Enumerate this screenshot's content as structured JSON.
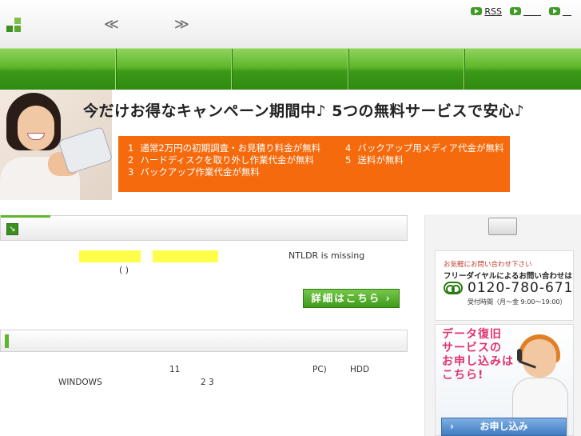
{
  "header": {
    "nav_prev": "≪",
    "nav_next": "≫",
    "links": [
      {
        "label": "RSS",
        "icon": "play-icon"
      },
      {
        "label": "＿＿",
        "icon": "play-icon"
      },
      {
        "label": "＿",
        "icon": "play-icon"
      }
    ]
  },
  "nav": {
    "items": [
      "",
      "",
      "",
      "",
      ""
    ]
  },
  "banner": {
    "headline": "今だけお得なキャンペーン期間中♪ 5つの無料サービスで安心♪",
    "campaign_items": [
      {
        "num": "1",
        "text": "通常2万円の初期調査・お見積り料金が無料"
      },
      {
        "num": "2",
        "text": "ハードディスクを取り外し作業代金が無料"
      },
      {
        "num": "3",
        "text": "バックアップ作業代金が無料"
      },
      {
        "num": "4",
        "text": "バックアップ用メディア代金が無料"
      },
      {
        "num": "5",
        "text": "送料が無料"
      }
    ],
    "box_color": "#f46a0c"
  },
  "main": {
    "error_text": "NTLDR is missing",
    "paren_text": "(    )",
    "details_button": "詳細はこちら ›",
    "body_line1": {
      "a": "11",
      "b": "PC)",
      "c": "HDD"
    },
    "body_line2": {
      "a": "WINDOWS",
      "b": "2  3"
    }
  },
  "sidebar": {
    "contact_small": "お気軽にお問い合わせ下さい",
    "contact_main": "フリーダイヤルによるお問い合わせは",
    "phone": "0120-780-671",
    "hours": "受付時間（月～金  9:00～19:00）",
    "apply_lines": [
      "データ復旧",
      "サービスの",
      "お申し込みは",
      "こちら!"
    ],
    "apply_button": "お申し込み"
  },
  "colors": {
    "brand_green": "#5eb62a",
    "accent_pink": "#e0326e",
    "apply_blue": "#3f7cc3"
  }
}
